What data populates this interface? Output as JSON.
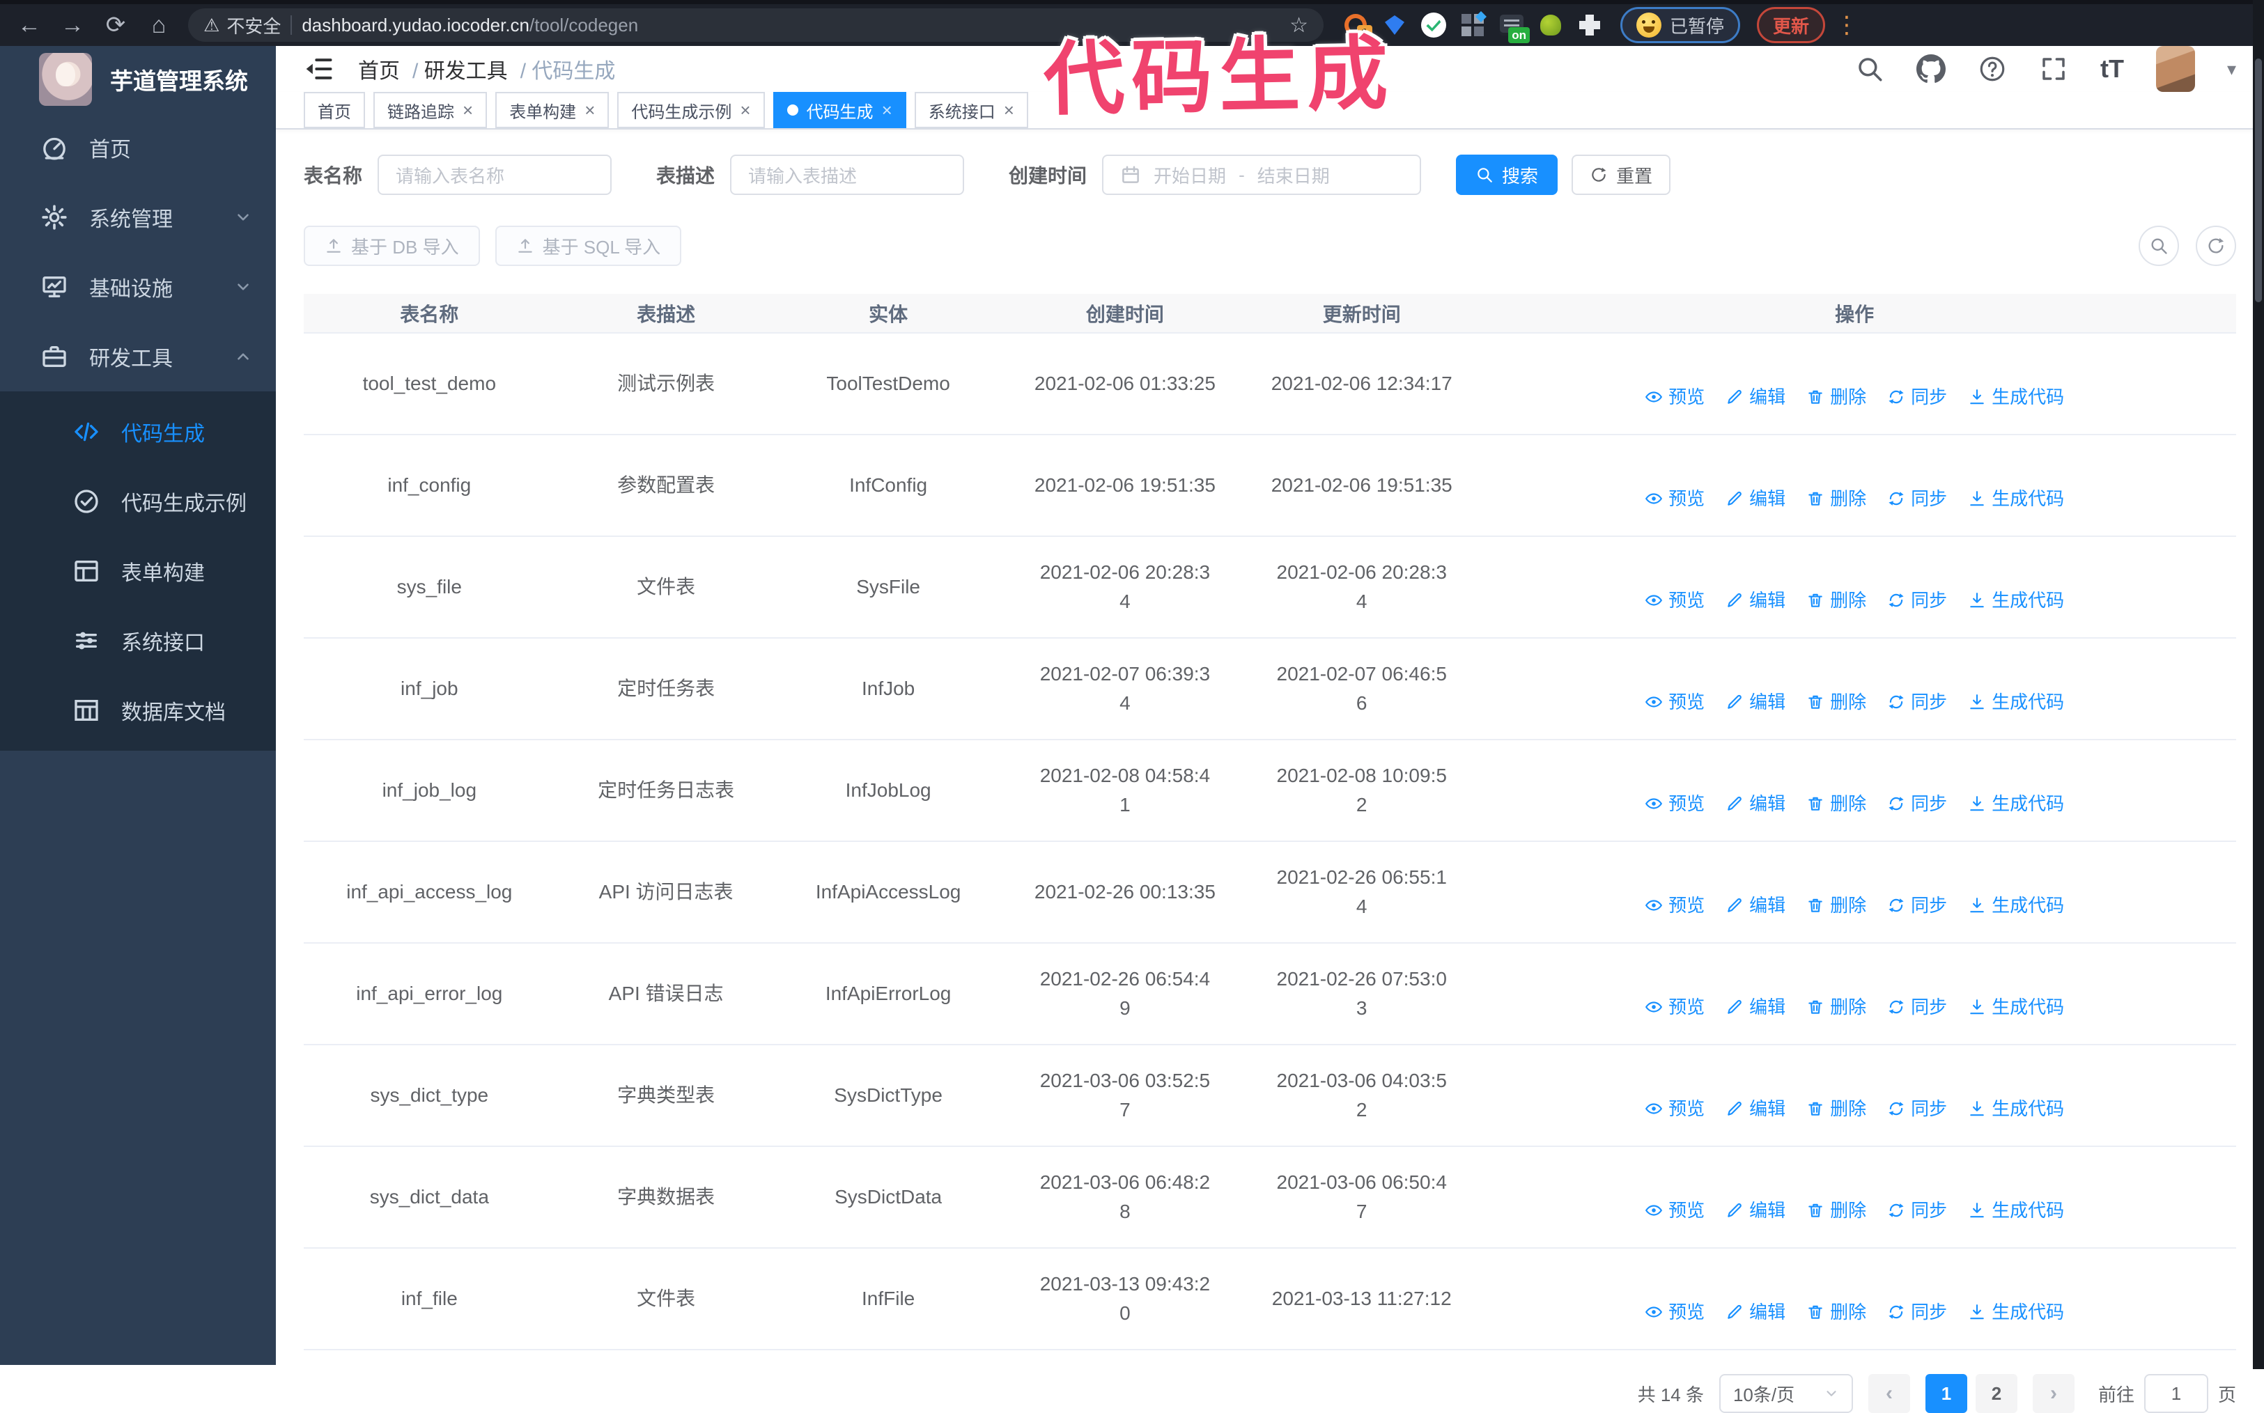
{
  "browser": {
    "back": "←",
    "forward": "→",
    "reload": "⟳",
    "home": "⌂",
    "warning": "⚠",
    "security_label": "不安全",
    "url_host": "dashboard.yudao.iocoder.cn",
    "url_path": "/tool/codegen",
    "bookmark_star": "☆",
    "ext_badge": "1",
    "ext_on_badge": "on",
    "paused_label": "已暂停",
    "update_label": "更新",
    "menu_dots": "⋮"
  },
  "annotation": {
    "text": "代码生成"
  },
  "sidebar": {
    "title": "芋道管理系统",
    "items": [
      {
        "label": "首页",
        "icon": "#i-gauge",
        "dn": "sidebar-item-home"
      },
      {
        "label": "系统管理",
        "icon": "#i-gear",
        "chev_down": true,
        "dn": "sidebar-item-system"
      },
      {
        "label": "基础设施",
        "icon": "#i-monitor",
        "chev_down": true,
        "dn": "sidebar-item-infra"
      },
      {
        "label": "研发工具",
        "icon": "#i-briefcase",
        "chev_up": true,
        "dn": "sidebar-item-devtools"
      }
    ],
    "submenu": [
      {
        "label": "代码生成",
        "icon": "#i-code",
        "active": true,
        "dn": "sidebar-item-codegen"
      },
      {
        "label": "代码生成示例",
        "icon": "#i-check-circle",
        "dn": "sidebar-item-codegen-example"
      },
      {
        "label": "表单构建",
        "icon": "#i-form",
        "dn": "sidebar-item-form-builder"
      },
      {
        "label": "系统接口",
        "icon": "#i-sliders",
        "dn": "sidebar-item-api"
      },
      {
        "label": "数据库文档",
        "icon": "#i-dbdoc",
        "dn": "sidebar-item-db-doc"
      }
    ]
  },
  "header": {
    "sep": "/",
    "breadcrumb": [
      {
        "label": "首页"
      },
      {
        "label": "研发工具",
        "sep": true
      },
      {
        "label": "代码生成",
        "sep": true,
        "active": true
      }
    ],
    "font_size_label": "tT",
    "caret": "▾"
  },
  "tabbar": {
    "close": "×",
    "items": [
      {
        "label": "首页",
        "dn": "tab-home"
      },
      {
        "label": "链路追踪",
        "closable": true,
        "dn": "tab-tracing"
      },
      {
        "label": "表单构建",
        "closable": true,
        "dn": "tab-form-builder"
      },
      {
        "label": "代码生成示例",
        "closable": true,
        "dn": "tab-codegen-example"
      },
      {
        "label": "代码生成",
        "closable": true,
        "active": true,
        "dn": "tab-codegen"
      },
      {
        "label": "系统接口",
        "closable": true,
        "dn": "tab-api"
      }
    ]
  },
  "filters": {
    "table_name_label": "表名称",
    "table_name_placeholder": "请输入表名称",
    "table_desc_label": "表描述",
    "table_desc_placeholder": "请输入表描述",
    "created_label": "创建时间",
    "date_start_placeholder": "开始日期",
    "date_separator": "-",
    "date_end_placeholder": "结束日期",
    "search_label": "搜索",
    "reset_label": "重置"
  },
  "toolbar": {
    "import_db_label": "基于 DB 导入",
    "import_sql_label": "基于 SQL 导入"
  },
  "table": {
    "columns": [
      "表名称",
      "表描述",
      "实体",
      "创建时间",
      "更新时间",
      "操作"
    ],
    "actions": [
      {
        "label": "预览",
        "icon": "#i-eye",
        "dn": "action-preview-link"
      },
      {
        "label": "编辑",
        "icon": "#i-edit",
        "dn": "action-edit-link"
      },
      {
        "label": "删除",
        "icon": "#i-trash",
        "dn": "action-delete-link"
      },
      {
        "label": "同步",
        "icon": "#i-sync",
        "dn": "action-sync-link"
      },
      {
        "label": "生成代码",
        "icon": "#i-download",
        "dn": "action-generate-link"
      }
    ],
    "rows": [
      {
        "name": "tool_test_demo",
        "desc": "测试示例表",
        "entity": "ToolTestDemo",
        "created": "2021-02-06 01:33:25",
        "updated": "2021-02-06 12:34:17"
      },
      {
        "name": "inf_config",
        "desc": "参数配置表",
        "entity": "InfConfig",
        "created": "2021-02-06 19:51:35",
        "updated": "2021-02-06 19:51:35"
      },
      {
        "name": "sys_file",
        "desc": "文件表",
        "entity": "SysFile",
        "created": "2021-02-06 20:28:3\n4",
        "updated": "2021-02-06 20:28:3\n4"
      },
      {
        "name": "inf_job",
        "desc": "定时任务表",
        "entity": "InfJob",
        "created": "2021-02-07 06:39:3\n4",
        "updated": "2021-02-07 06:46:5\n6"
      },
      {
        "name": "inf_job_log",
        "desc": "定时任务日志表",
        "entity": "InfJobLog",
        "created": "2021-02-08 04:58:4\n1",
        "updated": "2021-02-08 10:09:5\n2"
      },
      {
        "name": "inf_api_access_log",
        "desc": "API 访问日志表",
        "entity": "InfApiAccessLog",
        "created": "2021-02-26 00:13:35",
        "updated": "2021-02-26 06:55:1\n4"
      },
      {
        "name": "inf_api_error_log",
        "desc": "API 错误日志",
        "entity": "InfApiErrorLog",
        "created": "2021-02-26 06:54:4\n9",
        "updated": "2021-02-26 07:53:0\n3"
      },
      {
        "name": "sys_dict_type",
        "desc": "字典类型表",
        "entity": "SysDictType",
        "created": "2021-03-06 03:52:5\n7",
        "updated": "2021-03-06 04:03:5\n2"
      },
      {
        "name": "sys_dict_data",
        "desc": "字典数据表",
        "entity": "SysDictData",
        "created": "2021-03-06 06:48:2\n8",
        "updated": "2021-03-06 06:50:4\n7"
      },
      {
        "name": "inf_file",
        "desc": "文件表",
        "entity": "InfFile",
        "created": "2021-03-13 09:43:2\n0",
        "updated": "2021-03-13 11:27:12"
      }
    ]
  },
  "pagination": {
    "total": "共 14 条",
    "page_size": "10条/页",
    "prev": "‹",
    "next": "›",
    "pages": [
      {
        "label": "1",
        "active": true,
        "dn": "page-button-1"
      },
      {
        "label": "2",
        "dn": "page-button-2"
      }
    ],
    "goto_label": "前往",
    "goto_value": "1",
    "goto_suffix": "页"
  }
}
